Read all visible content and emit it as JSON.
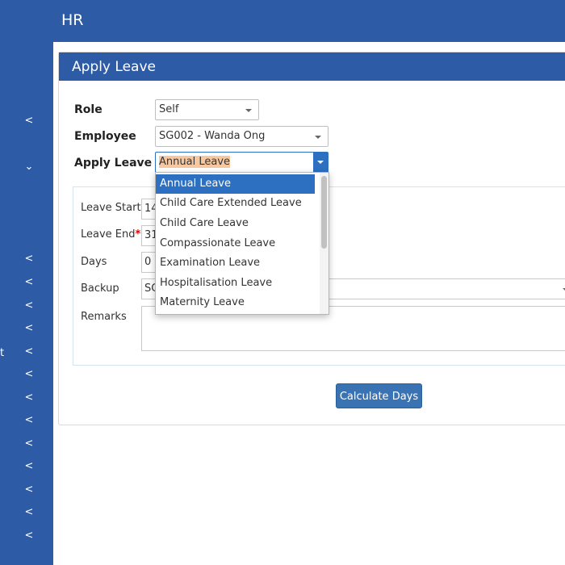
{
  "app": {
    "title": "HR"
  },
  "sidebar": {
    "chevrons": [
      "<",
      "⌄",
      "<",
      "<",
      "<",
      "<",
      "<",
      "<",
      "<",
      "<",
      "<",
      "<",
      "<",
      "<",
      "<"
    ],
    "fragment": "t"
  },
  "panel": {
    "title": "Apply Leave"
  },
  "form": {
    "role": {
      "label": "Role",
      "value": "Self"
    },
    "employee": {
      "label": "Employee",
      "value": "SG002 - Wanda Ong"
    },
    "apply_leave": {
      "label": "Apply Leave",
      "value": "Annual Leave"
    }
  },
  "details": {
    "leave_start": {
      "label": "Leave Start",
      "required": "*",
      "value": "14"
    },
    "leave_end": {
      "label": "Leave End",
      "required": "*",
      "value": "31"
    },
    "days": {
      "label": "Days",
      "value": "0"
    },
    "backup": {
      "label": "Backup",
      "value": "SG"
    },
    "remarks": {
      "label": "Remarks",
      "value": ""
    }
  },
  "actions": {
    "calculate_label": "Calculate Days"
  },
  "dropdown": {
    "options": [
      "Annual Leave",
      "Child Care Extended Leave",
      "Child Care Leave",
      "Compassionate Leave",
      "Examination Leave",
      "Hospitalisation Leave",
      "Maternity Leave"
    ],
    "selected": "Annual Leave"
  },
  "colors": {
    "primary": "#2d5ba6",
    "accent": "#2d6fc0",
    "highlight": "#f7c8a0",
    "required": "#dd0000"
  }
}
